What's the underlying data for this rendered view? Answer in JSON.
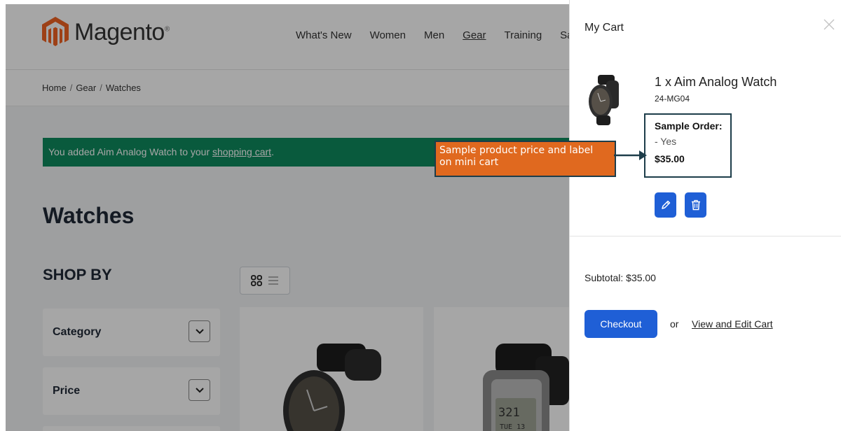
{
  "header": {
    "logo_text": "Magento",
    "logo_reg": "®",
    "nav": [
      "What's New",
      "Women",
      "Men",
      "Gear",
      "Training",
      "Sa"
    ]
  },
  "breadcrumbs": [
    "Home",
    "Gear",
    "Watches"
  ],
  "message": {
    "prefix": "You added Aim Analog Watch to your ",
    "link": "shopping cart",
    "suffix": "."
  },
  "page_title": "Watches",
  "shop_by": "SHOP BY",
  "filters": [
    "Category",
    "Price"
  ],
  "minicart": {
    "title": "My Cart",
    "item": {
      "name": "1 x Aim Analog Watch",
      "sku": "24-MG04",
      "option_label": "Sample Order:",
      "option_value": "- Yes",
      "price": "$35.00"
    },
    "subtotal": "Subtotal: $35.00",
    "checkout_label": "Checkout",
    "or_text": "or",
    "view_edit_label": "View and Edit Cart"
  },
  "annotation": {
    "line1": "Sample product price and label",
    "line2": "on mini cart"
  },
  "colors": {
    "accent_blue": "#1f5fd6",
    "success_green": "#0f8a5e",
    "annotation_orange": "#e0691f",
    "logo_orange": "#f26322"
  }
}
